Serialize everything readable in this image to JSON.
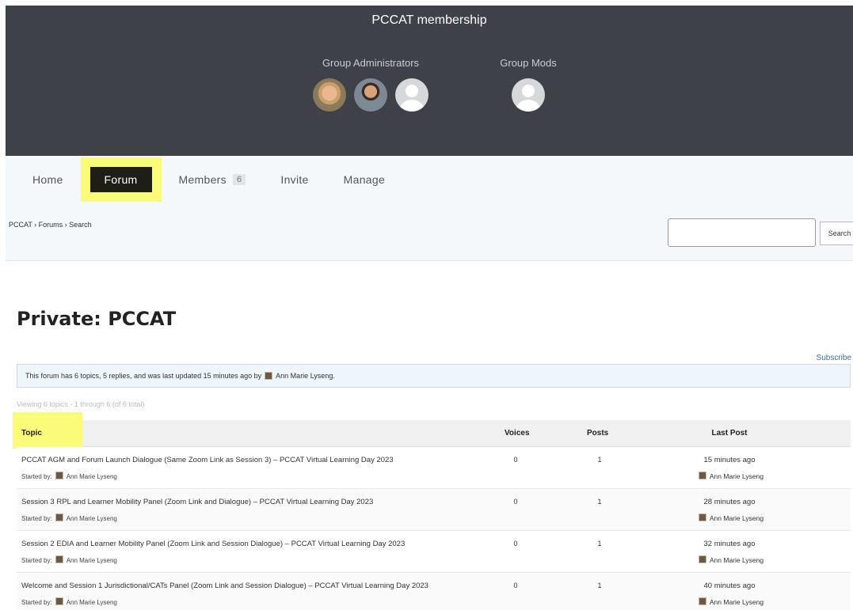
{
  "header": {
    "title": "PCCAT membership",
    "admins_label": "Group Administrators",
    "mods_label": "Group Mods"
  },
  "nav": {
    "items": [
      {
        "label": "Home"
      },
      {
        "label": "Forum"
      },
      {
        "label": "Members",
        "count": "6"
      },
      {
        "label": "Invite"
      },
      {
        "label": "Manage"
      }
    ]
  },
  "breadcrumb": "PCCAT › Forums › Search",
  "search": {
    "button": "Search",
    "value": ""
  },
  "forum": {
    "title": "Private: PCCAT",
    "subscribe": "Subscribe",
    "notice_prefix": "This forum has 6 topics, 5 replies, and was last updated 15 minutes ago by",
    "notice_author": "Ann Marie Lyseng.",
    "viewing": "Viewing 6 topics - 1 through 6 (of 6 total)"
  },
  "table": {
    "headers": {
      "topic": "Topic",
      "voices": "Voices",
      "posts": "Posts",
      "last_post": "Last Post"
    },
    "started_label": "Started by:",
    "rows": [
      {
        "title": "PCCAT AGM and Forum Launch Dialogue (Same Zoom Link as Session 3) – PCCAT Virtual Learning Day 2023",
        "author": "Ann Marie Lyseng",
        "voices": "0",
        "posts": "1",
        "last_time": "15 minutes ago",
        "last_by": "Ann Marie Lyseng"
      },
      {
        "title": "Session 3 RPL and Learner Mobility Panel (Zoom Link and Dialogue) – PCCAT Virtual Learning Day 2023",
        "author": "Ann Marie Lyseng",
        "voices": "0",
        "posts": "1",
        "last_time": "28 minutes ago",
        "last_by": "Ann Marie Lyseng"
      },
      {
        "title": "Session 2 EDIA and Learner Mobility Panel (Zoom Link and Session Dialogue) – PCCAT Virtual Learning Day 2023",
        "author": "Ann Marie Lyseng",
        "voices": "0",
        "posts": "1",
        "last_time": "32 minutes ago",
        "last_by": "Ann Marie Lyseng"
      },
      {
        "title": "Welcome and Session 1 Jurisdictional/CATs Panel (Zoom Link and Session Dialogue) – PCCAT Virtual Learning Day 2023",
        "author": "Ann Marie Lyseng",
        "voices": "0",
        "posts": "1",
        "last_time": "40 minutes ago",
        "last_by": "Ann Marie Lyseng"
      }
    ]
  }
}
